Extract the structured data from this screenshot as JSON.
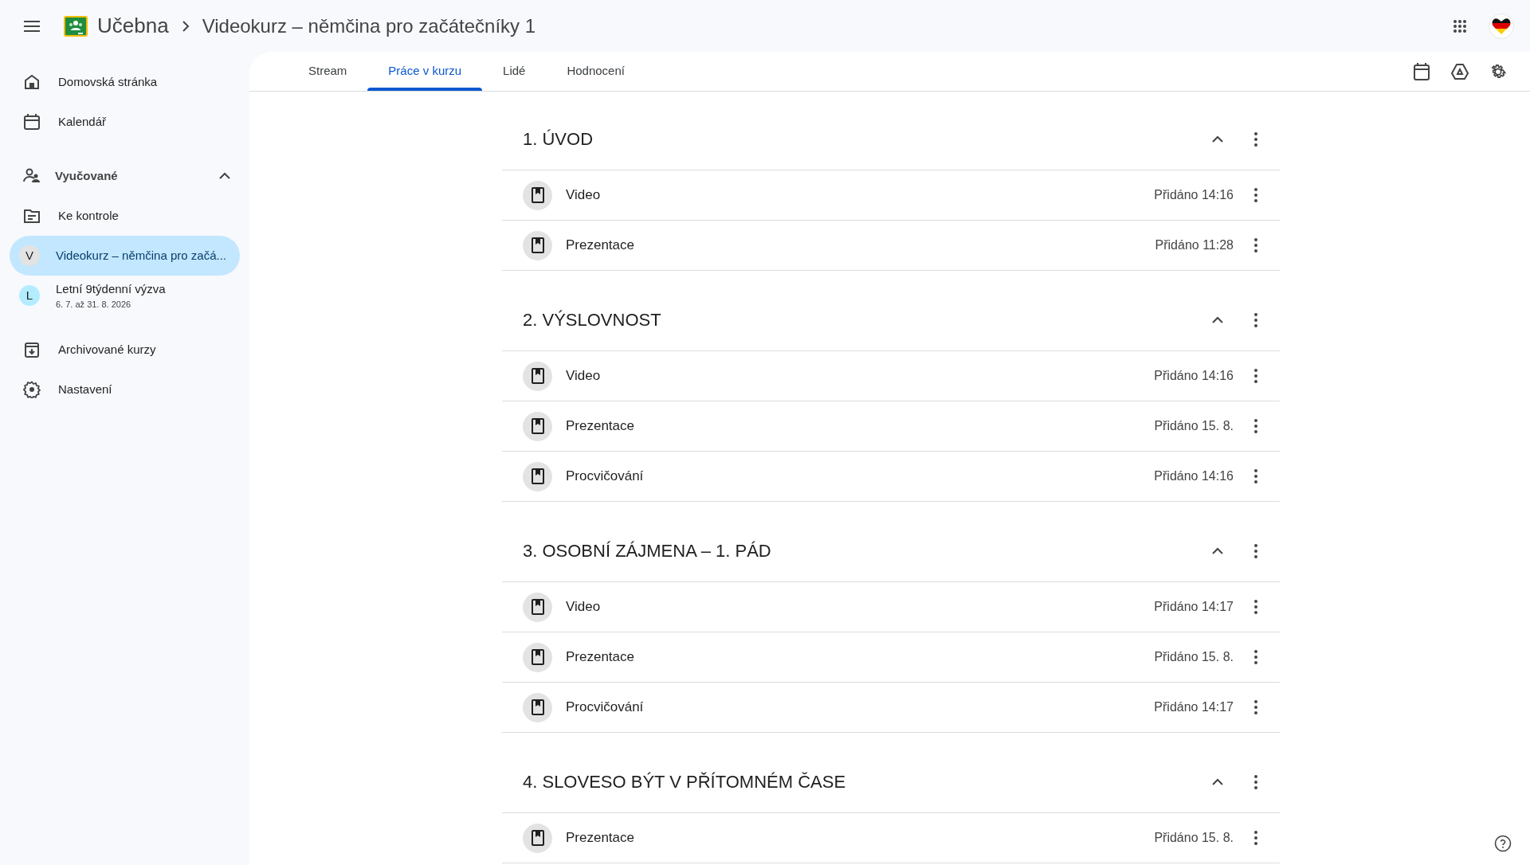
{
  "app": {
    "title": "Učebna",
    "breadcrumb": "Videokurz – němčina pro začátečníky 1"
  },
  "sidebar": {
    "items": [
      {
        "kind": "link",
        "label": "Domovská stránka",
        "selected": false
      },
      {
        "kind": "link",
        "label": "Kalendář",
        "selected": false
      },
      {
        "kind": "section",
        "label": "Vyučované",
        "expanded": true,
        "children": [
          {
            "kind": "link",
            "label": "Ke kontrole",
            "selected": false
          },
          {
            "kind": "course",
            "letter": "V",
            "label": "Videokurz – němčina pro začá...",
            "color": "#e3e3e3",
            "selected": true
          },
          {
            "kind": "course",
            "letter": "L",
            "label": "Letní 9týdenní výzva",
            "subtitle": "6. 7. až 31. 8. 2026",
            "color": "#b3ecff",
            "selected": false
          }
        ]
      },
      {
        "kind": "link",
        "label": "Archivované kurzy",
        "selected": false
      },
      {
        "kind": "link",
        "label": "Nastavení",
        "selected": false
      }
    ]
  },
  "tabs": [
    {
      "label": "Stream",
      "selected": false
    },
    {
      "label": "Práce v kurzu",
      "selected": true
    },
    {
      "label": "Lidé",
      "selected": false
    },
    {
      "label": "Hodnocení",
      "selected": false
    }
  ],
  "topics": [
    {
      "title": "1. ÚVOD",
      "expanded": true,
      "items": [
        {
          "title": "Video",
          "added": "Přidáno 14:16"
        },
        {
          "title": "Prezentace",
          "added": "Přidáno 11:28"
        }
      ]
    },
    {
      "title": "2. VÝSLOVNOST",
      "expanded": true,
      "items": [
        {
          "title": "Video",
          "added": "Přidáno 14:16"
        },
        {
          "title": "Prezentace",
          "added": "Přidáno 15. 8."
        },
        {
          "title": "Procvičování",
          "added": "Přidáno 14:16"
        }
      ]
    },
    {
      "title": "3. OSOBNÍ ZÁJMENA – 1. PÁD",
      "expanded": true,
      "items": [
        {
          "title": "Video",
          "added": "Přidáno 14:17"
        },
        {
          "title": "Prezentace",
          "added": "Přidáno 15. 8."
        },
        {
          "title": "Procvičování",
          "added": "Přidáno 14:17"
        }
      ]
    },
    {
      "title": "4. SLOVESO BÝT V PŘÍTOMNÉM ČASE",
      "expanded": true,
      "items": [
        {
          "title": "Prezentace",
          "added": "Přidáno 15. 8."
        }
      ]
    }
  ]
}
